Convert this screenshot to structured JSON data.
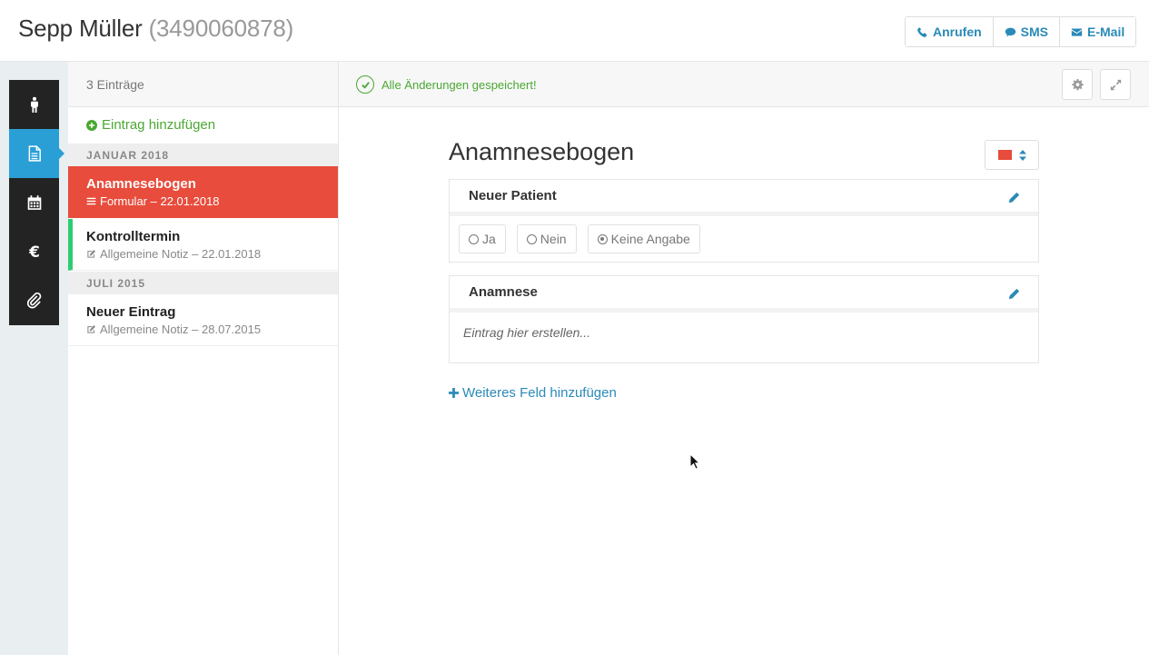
{
  "header": {
    "patient_name": "Sepp Müller",
    "patient_phone": "(3490060878)",
    "contact": {
      "call_label": "Anrufen",
      "sms_label": "SMS",
      "email_label": "E-Mail"
    }
  },
  "rail": {
    "items": [
      {
        "icon": "person-icon",
        "active": false
      },
      {
        "icon": "document-icon",
        "active": true
      },
      {
        "icon": "calendar-icon",
        "active": false
      },
      {
        "icon": "euro-icon",
        "active": false
      },
      {
        "icon": "paperclip-icon",
        "active": false
      }
    ]
  },
  "list": {
    "count_label": "3 Einträge",
    "add_label": "Eintrag hinzufügen",
    "groups": [
      {
        "label": "JANUAR 2018",
        "entries": [
          {
            "title": "Anamnesebogen",
            "subtitle": "Formular – 22.01.2018",
            "icon": "list-icon",
            "active": true
          },
          {
            "title": "Kontrolltermin",
            "subtitle": "Allgemeine Notiz – 22.01.2018",
            "icon": "edit-note-icon",
            "marked": true
          }
        ]
      },
      {
        "label": "JULI 2015",
        "entries": [
          {
            "title": "Neuer Eintrag",
            "subtitle": "Allgemeine Notiz – 28.07.2015",
            "icon": "edit-note-icon"
          }
        ]
      }
    ]
  },
  "main": {
    "status_text": "Alle Änderungen gespeichert!",
    "form_title": "Anamnesebogen",
    "selected_color": "#e74c3c",
    "fields": [
      {
        "title": "Neuer Patient",
        "options": [
          {
            "label": "Ja",
            "checked": false
          },
          {
            "label": "Nein",
            "checked": false
          },
          {
            "label": "Keine Angabe",
            "checked": true
          }
        ]
      },
      {
        "title": "Anamnese",
        "placeholder": "Eintrag hier erstellen..."
      }
    ],
    "add_field_label": "Weiteres Feld hinzufügen"
  },
  "colors": {
    "accent": "#2a9fd6",
    "link": "#2a8ab8",
    "success": "#4aa832",
    "active_entry": "#e74c3c",
    "marker": "#2ecc71",
    "rail": "#232323"
  }
}
